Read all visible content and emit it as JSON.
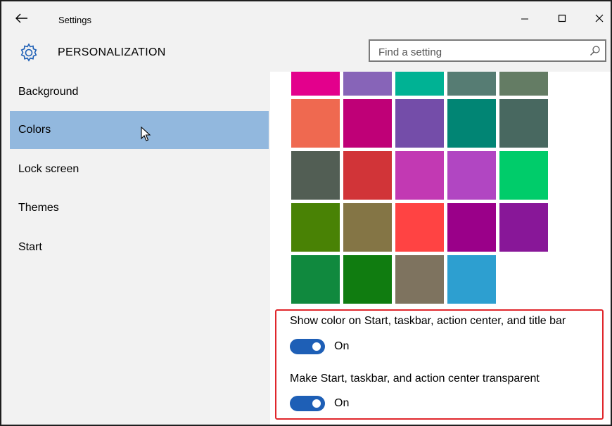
{
  "window": {
    "title": "Settings",
    "minimize_label": "—",
    "maximize_label": "☐",
    "close_label": "✕"
  },
  "header": {
    "section_title": "PERSONALIZATION",
    "search_placeholder": "Find a setting"
  },
  "sidebar": {
    "items": [
      {
        "label": "Background",
        "selected": false
      },
      {
        "label": "Colors",
        "selected": true
      },
      {
        "label": "Lock screen",
        "selected": false
      },
      {
        "label": "Themes",
        "selected": false
      },
      {
        "label": "Start",
        "selected": false
      }
    ]
  },
  "colors": {
    "swatches": [
      [
        "#e3008c",
        "#8764b8",
        "#00b294",
        "#567c73",
        "#647c64"
      ],
      [
        "#ef6950",
        "#bf0077",
        "#744da9",
        "#018574",
        "#486860"
      ],
      [
        "#525e54",
        "#d13438",
        "#c239b3",
        "#b146c2",
        "#00cc6a"
      ],
      [
        "#498205",
        "#847545",
        "#ff4343",
        "#9a0089",
        "#881798"
      ],
      [
        "#10893e",
        "#107c10",
        "#7e735f",
        "#2d9fd0"
      ]
    ],
    "accent": "#1e5fb6",
    "selected_nav_bg": "#92b8de",
    "highlight_border": "#e0262b"
  },
  "options": {
    "show_color": {
      "label": "Show color on Start, taskbar, action center, and title bar",
      "state": "On"
    },
    "transparent": {
      "label": "Make Start, taskbar, and action center transparent",
      "state": "On"
    }
  }
}
